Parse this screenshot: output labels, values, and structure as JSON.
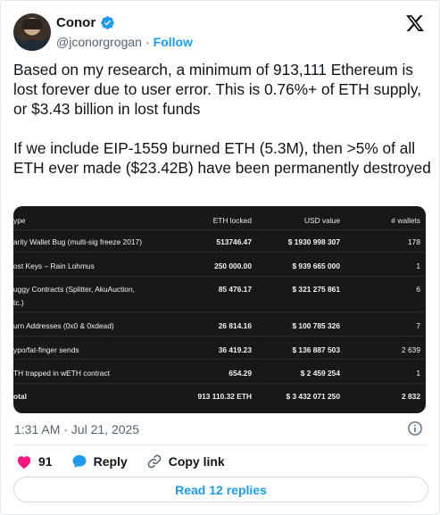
{
  "author": {
    "name": "Conor",
    "handle": "@jconorgrogan",
    "separator": "·",
    "follow_label": "Follow"
  },
  "tweet": {
    "paragraphs": [
      "Based on my research, a minimum of 913,111 Ethereum is lost forever due to user error.  This is 0.76%+ of ETH supply, or $3.43 billion in lost funds",
      "If we include EIP-1559 burned ETH (5.3M), then >5% of all ETH ever made ($23.42B) have been permanently destroyed"
    ],
    "timestamp": "1:31 AM · Jul 21, 2025"
  },
  "table": {
    "headers": [
      "ype",
      "ETH locked",
      "USD value",
      "# wallets"
    ],
    "rows": [
      [
        "arity Wallet Bug (multi-sig freeze 2017)",
        "513746.47",
        "$ 1930 998 307",
        "178"
      ],
      [
        "ost Keys – Rain Lohmus",
        "250 000.00",
        "$ 939 665 000",
        "1"
      ],
      [
        "uggy Contracts (Splitter, AkuAuction,",
        "85 476.17",
        "$ 321 275 861",
        "6"
      ],
      [
        "tc.)",
        "",
        "",
        ""
      ],
      [
        "urn Addresses (0x0 & 0xdead)",
        "26 814.16",
        "$ 100 785 326",
        "7"
      ],
      [
        "ypo/fat-finger sends",
        "36 419.23",
        "$ 136 887 503",
        "2 639"
      ],
      [
        "TH trapped in wETH contract",
        "654.29",
        "$ 2 459 254",
        "1"
      ]
    ],
    "total": [
      "otal",
      "913 110.32 ETH",
      "$ 3 432 071 250",
      "2 832"
    ]
  },
  "actions": {
    "like_count": "91",
    "reply_label": "Reply",
    "copy_link_label": "Copy link",
    "read_replies_label": "Read 12 replies"
  },
  "colors": {
    "accent": "#1d9bf0",
    "like": "#f91880",
    "muted": "#536471",
    "media_bg": "#181818"
  },
  "icons": {
    "verified": "verified-badge-icon",
    "logo": "x-logo-icon",
    "info": "info-icon",
    "like": "heart-icon",
    "reply": "reply-bubble-icon",
    "copy": "link-icon"
  }
}
